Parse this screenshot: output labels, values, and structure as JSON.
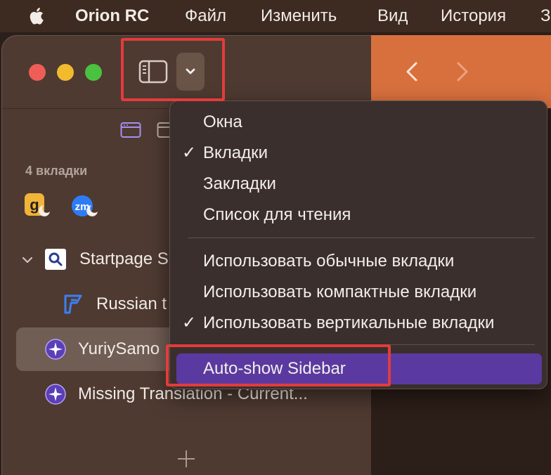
{
  "menubar": {
    "app_name": "Orion RC",
    "items": [
      "Файл",
      "Изменить",
      "Вид",
      "История",
      "З"
    ]
  },
  "sidebar": {
    "section_label": "4 вкладки",
    "pinned": [
      {
        "icon": "g-favicon",
        "color": "#f0b43a"
      },
      {
        "icon": "zm-favicon",
        "color": "#2d7cf6"
      }
    ],
    "tabs": [
      {
        "title": "Startpage S",
        "icon": "startpage-favicon",
        "expanded": true
      },
      {
        "title": "Russian t",
        "icon": "prompt-favicon",
        "indent": true
      },
      {
        "title": "YuriySamo",
        "icon": "orion-favicon",
        "active": true
      },
      {
        "title": "Missing Translation - Current...",
        "icon": "orion-favicon"
      }
    ]
  },
  "menu": {
    "group1": [
      {
        "label": "Окна",
        "checked": false
      },
      {
        "label": "Вкладки",
        "checked": true
      },
      {
        "label": "Закладки",
        "checked": false
      },
      {
        "label": "Список для чтения",
        "checked": false
      }
    ],
    "group2": [
      {
        "label": "Использовать обычные вкладки",
        "checked": false
      },
      {
        "label": "Использовать компактные вкладки",
        "checked": false
      },
      {
        "label": "Использовать вертикальные вкладки",
        "checked": true
      }
    ],
    "group3": [
      {
        "label": "Auto-show Sidebar",
        "checked": false,
        "highlighted": true
      }
    ],
    "check_glyph": "✓"
  },
  "colors": {
    "accent": "#5a3aa0",
    "browser_toolbar": "#d8703e",
    "annotation": "#e23c3c"
  }
}
